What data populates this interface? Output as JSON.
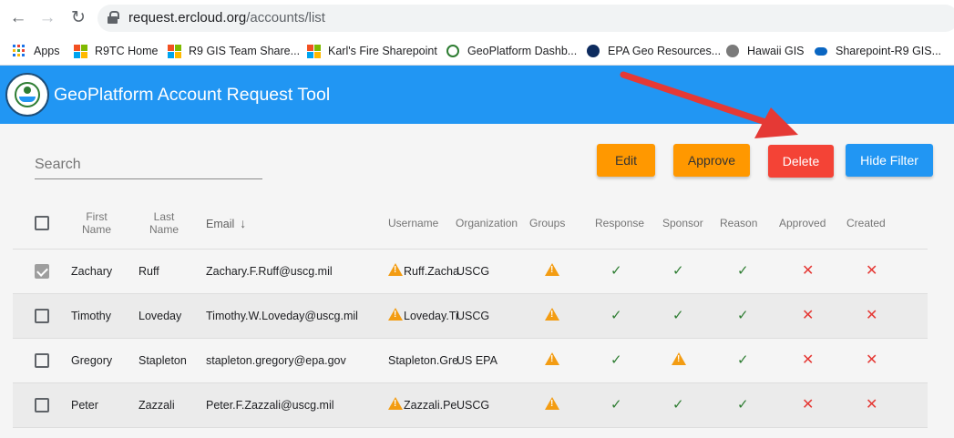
{
  "browser": {
    "url_host": "request.ercloud.org",
    "url_path": "/accounts/list",
    "bookmarks": [
      {
        "label": "Apps",
        "icon": "apps-grid-icon"
      },
      {
        "label": "R9TC Home",
        "icon": "microsoft-logo-icon"
      },
      {
        "label": "R9 GIS Team Share...",
        "icon": "microsoft-logo-icon"
      },
      {
        "label": "Karl's Fire Sharepoint",
        "icon": "microsoft-logo-icon"
      },
      {
        "label": "GeoPlatform Dashb...",
        "icon": "geoplatform-icon"
      },
      {
        "label": "EPA Geo Resources...",
        "icon": "epa-icon"
      },
      {
        "label": "Hawaii GIS",
        "icon": "flower-icon"
      },
      {
        "label": "Sharepoint-R9 GIS...",
        "icon": "cloud-icon"
      }
    ]
  },
  "app": {
    "title": "GeoPlatform Account Request Tool",
    "accent_color": "#2196f3"
  },
  "toolbar": {
    "search_placeholder": "Search",
    "edit_label": "Edit",
    "approve_label": "Approve",
    "delete_label": "Delete",
    "hide_filter_label": "Hide Filter"
  },
  "table": {
    "headers": {
      "first_name": "First Name",
      "last_name": "Last Name",
      "email": "Email",
      "username": "Username",
      "organization": "Organization",
      "groups": "Groups",
      "response": "Response",
      "sponsor": "Sponsor",
      "reason": "Reason",
      "approved": "Approved",
      "created": "Created"
    },
    "sort_column": "email",
    "rows": [
      {
        "selected": true,
        "first": "Zachary",
        "last": "Ruff",
        "email": "Zachary.F.Ruff@uscg.mil",
        "username": "Ruff.Zacha",
        "username_warning": true,
        "org": "USCG",
        "groups": "warning",
        "response": "check",
        "sponsor": "check",
        "reason": "check",
        "approved": "cross",
        "created": "cross"
      },
      {
        "selected": false,
        "first": "Timothy",
        "last": "Loveday",
        "email": "Timothy.W.Loveday@uscg.mil",
        "username": "Loveday.Ti",
        "username_warning": true,
        "org": "USCG",
        "groups": "warning",
        "response": "check",
        "sponsor": "check",
        "reason": "check",
        "approved": "cross",
        "created": "cross"
      },
      {
        "selected": false,
        "first": "Gregory",
        "last": "Stapleton",
        "email": "stapleton.gregory@epa.gov",
        "username": "Stapleton.Gre",
        "username_warning": false,
        "org": "US EPA",
        "groups": "warning",
        "response": "check",
        "sponsor": "warning",
        "reason": "check",
        "approved": "cross",
        "created": "cross"
      },
      {
        "selected": false,
        "first": "Peter",
        "last": "Zazzali",
        "email": "Peter.F.Zazzali@uscg.mil",
        "username": "Zazzali.Pe",
        "username_warning": true,
        "org": "USCG",
        "groups": "warning",
        "response": "check",
        "sponsor": "check",
        "reason": "check",
        "approved": "cross",
        "created": "cross"
      }
    ]
  },
  "annotation": {
    "color": "#e53935",
    "target": "delete-button"
  }
}
